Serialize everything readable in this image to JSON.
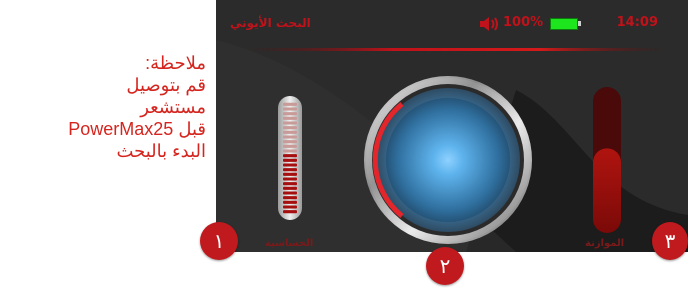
{
  "note": {
    "heading": "ملاحظة:",
    "line1": "قم بتوصيل مستشعر",
    "line2": "PowerMax25 قبل",
    "line3": "البدء بالبحث"
  },
  "status_bar": {
    "app_title": "البحث الأيوني",
    "battery_percent": "100%",
    "time": "14:09",
    "speaker_icon": "speaker-icon",
    "battery_color": "#1ee61e"
  },
  "meters": {
    "sensitivity_label": "الحساسية",
    "balance_label": "الموازنة",
    "sensitivity_segments_total": 24,
    "sensitivity_segments_active": 13,
    "balance_level": 0.58
  },
  "badges": [
    "١",
    "٢",
    "٣"
  ],
  "colors": {
    "accent": "#c0121a",
    "screen_bg": "#2b2b2b",
    "badge_bg": "#c01a1e"
  }
}
